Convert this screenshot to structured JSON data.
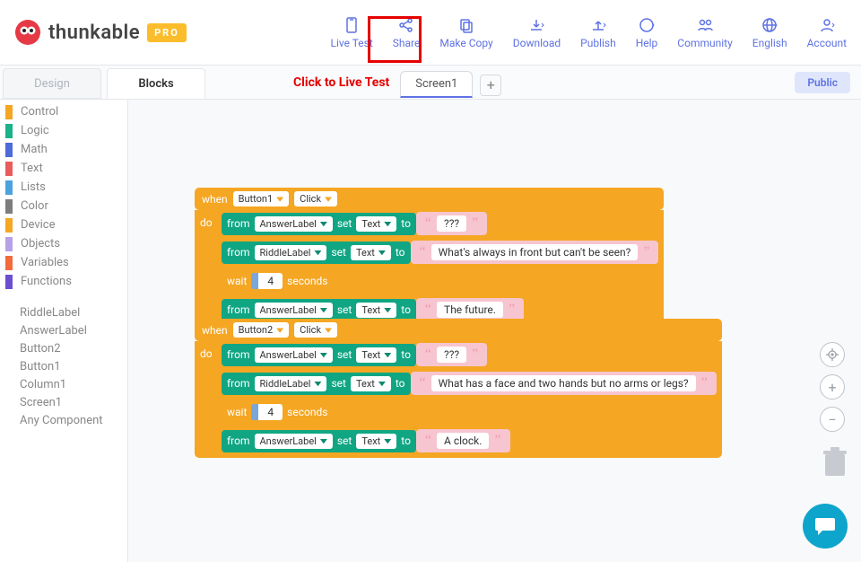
{
  "brand": "thunkable",
  "pro_label": "PRO",
  "toolbar": {
    "live_test": "Live Test",
    "share": "Share",
    "make_copy": "Make Copy",
    "download": "Download",
    "publish": "Publish",
    "help": "Help",
    "community": "Community",
    "english": "English",
    "account": "Account"
  },
  "annotation": "Click to Live Test",
  "mode_tabs": {
    "design": "Design",
    "blocks": "Blocks"
  },
  "screen_tab": "Screen1",
  "public_label": "Public",
  "sidebar_categories": [
    {
      "label": "Control",
      "color": "#f5a623"
    },
    {
      "label": "Logic",
      "color": "#1bb28a"
    },
    {
      "label": "Math",
      "color": "#4d6bd9"
    },
    {
      "label": "Text",
      "color": "#e85c5c"
    },
    {
      "label": "Lists",
      "color": "#4aa3df"
    },
    {
      "label": "Color",
      "color": "#7d7d7d"
    },
    {
      "label": "Device",
      "color": "#f5a623"
    },
    {
      "label": "Objects",
      "color": "#b6a1e6"
    },
    {
      "label": "Variables",
      "color": "#f36b3b"
    },
    {
      "label": "Functions",
      "color": "#6a4fd1"
    }
  ],
  "sidebar_components": [
    "RiddleLabel",
    "AnswerLabel",
    "Button2",
    "Button1",
    "Column1",
    "Screen1",
    "Any Component"
  ],
  "blocks": {
    "kw_when": "when",
    "kw_do": "do",
    "kw_from": "from",
    "kw_set": "set",
    "kw_to": "to",
    "kw_click": "Click",
    "kw_text": "Text",
    "kw_wait": "wait",
    "kw_seconds": "seconds",
    "button1": "Button1",
    "button2": "Button2",
    "answer_label": "AnswerLabel",
    "riddle_label": "RiddleLabel",
    "num4": "4",
    "val_qqq": "???",
    "riddle1_q": "What's always in front but can't be seen?",
    "riddle1_a": "The future.",
    "riddle2_q": "What has a face and two hands but no arms or legs?",
    "riddle2_a": "A clock."
  }
}
